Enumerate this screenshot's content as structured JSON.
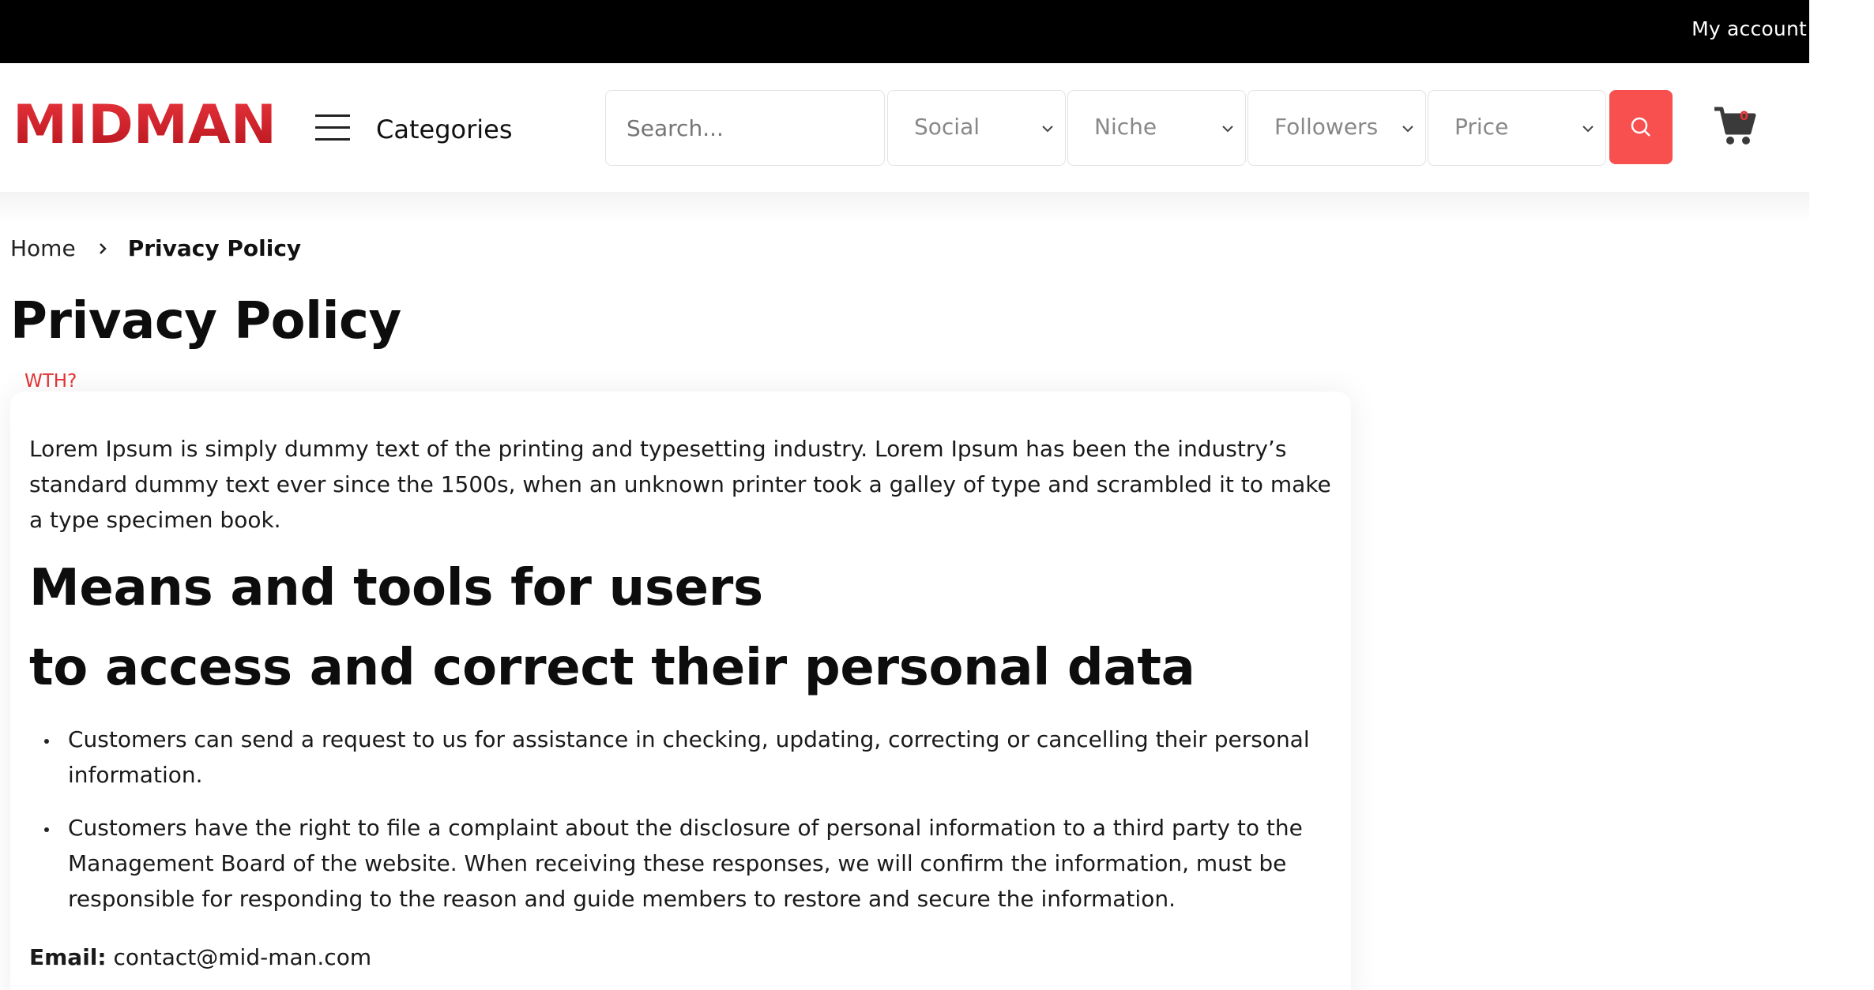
{
  "topbar": {
    "account_label": "My account"
  },
  "header": {
    "logo_text": "MIDMAN",
    "categories_label": "Categories",
    "search_placeholder": "Search...",
    "filters": [
      {
        "label": "Social"
      },
      {
        "label": "Niche"
      },
      {
        "label": "Followers"
      },
      {
        "label": "Price"
      }
    ],
    "cart_count": "0"
  },
  "breadcrumb": {
    "home": "Home",
    "current": "Privacy Policy"
  },
  "page": {
    "title": "Privacy Policy",
    "note": "WTH?",
    "intro": "Lorem Ipsum is simply dummy text of the printing and typesetting industry. Lorem Ipsum has been the industry’s standard dummy text ever since the 1500s, when an unknown printer took a galley of type and scrambled it to make a type specimen book.",
    "heading_line1": "Means and tools for users",
    "heading_line2": "to access and correct their personal data",
    "bullets": [
      "Customers can send a request to us for assistance in checking, updating, correcting or cancelling their personal information.",
      "Customers have the right to file a complaint about the disclosure of personal information to a third party to the Management Board of the website. When receiving these responses, we will confirm the information, must be responsible for responding to the reason and guide members to restore and secure the information."
    ],
    "email_label": "Email:",
    "email_value": "contact@mid-man.com"
  },
  "colors": {
    "accent": "#f84f4f",
    "logo_red": "#d9252e",
    "topbar": "#000000"
  }
}
